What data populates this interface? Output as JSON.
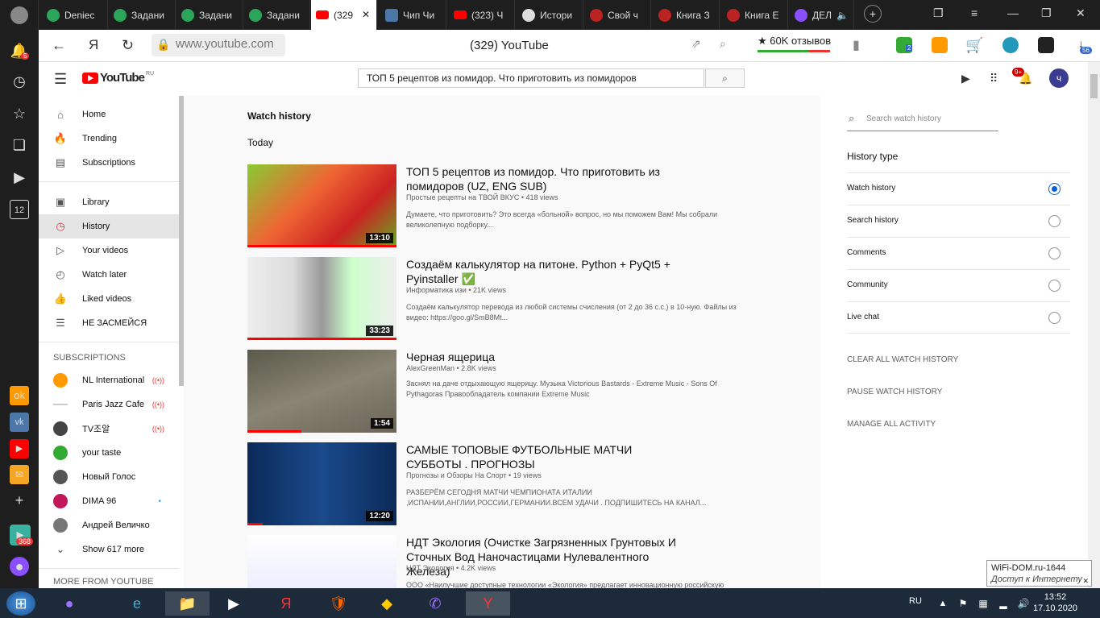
{
  "browser": {
    "tabs": [
      {
        "label": "Deniec",
        "icon": "green-circle-icon",
        "active": false
      },
      {
        "label": "Задани",
        "icon": "green-circle-icon",
        "active": false
      },
      {
        "label": "Задани",
        "icon": "green-circle-icon",
        "active": false
      },
      {
        "label": "Задани",
        "icon": "green-circle-icon",
        "active": false
      },
      {
        "label": "(329",
        "icon": "youtube-icon",
        "active": true
      },
      {
        "label": "Чип Чи",
        "icon": "vk-icon",
        "active": false
      },
      {
        "label": "(323) Ч",
        "icon": "youtube-icon",
        "active": false
      },
      {
        "label": "Истори",
        "icon": "clock-icon",
        "active": false
      },
      {
        "label": "Свой ч",
        "icon": "red-logo-icon",
        "active": false
      },
      {
        "label": "Книга З",
        "icon": "red-logo-icon",
        "active": false
      },
      {
        "label": "Книга Е",
        "icon": "red-logo-icon",
        "active": false
      },
      {
        "label": "ДЕЛ",
        "icon": "purple-icon",
        "active": false
      }
    ],
    "notif_count": "5",
    "left_badge": "12",
    "url": "www.youtube.com",
    "page_title": "(329) YouTube",
    "rating": "★ 60K отзывов",
    "download_count": "56",
    "ext_badge": "2",
    "left_app_badge": "368"
  },
  "yt": {
    "logo": "YouTube",
    "logo_region": "RU",
    "search_value": "ТОП 5 рецептов из помидор. Что приготовить из помидоров",
    "notif_badge": "9+",
    "avatar_letter": "ч"
  },
  "sidebar": {
    "main": [
      "Home",
      "Trending",
      "Subscriptions"
    ],
    "library": [
      "Library",
      "History",
      "Your videos",
      "Watch later",
      "Liked videos",
      "НЕ ЗАСМЕЙСЯ"
    ],
    "subs_header": "SUBSCRIPTIONS",
    "subs": [
      "NL International",
      "Paris Jazz Cafe",
      "TV조알",
      "your taste",
      "Новый Голос",
      "DIMA 96",
      "Андрей Величко"
    ],
    "show_more": "Show 617 more",
    "more_header": "MORE FROM YOUTUBE"
  },
  "main": {
    "title": "Watch history",
    "section": "Today",
    "videos": [
      {
        "title": "ТОП 5 рецептов из помидор. Что приготовить из помидоров (UZ, ENG SUB)",
        "meta": "Простые рецепты на ТВОЙ ВКУС • 418 views",
        "desc": "Думаете, что приготовить? Это всегда «больной» вопрос, но мы поможем Вам! Мы собрали великолепную подборку...",
        "duration": "13:10",
        "progress": 100
      },
      {
        "title": "Создаём калькулятор на питоне. Python + PyQt5 + Pyinstaller ✅",
        "meta": "Информатика изи • 21K views",
        "desc": "Создаём калькулятор перевода из любой системы счисления (от 2 до 36 с.с.) в 10-ную. Файлы из видео: https://goo.gl/SmB8Mt...",
        "duration": "33:23",
        "progress": 100
      },
      {
        "title": "Черная ящерица",
        "meta": "AlexGreenMan • 2.8K views",
        "desc": "Заснял на даче отдыхающую ящерицу. Музыка Victorious Bastards - Extreme Music - Sons Of Pythagoras Правообладатель компании Extreme Music",
        "duration": "1:54",
        "progress": 36
      },
      {
        "title": "САМЫЕ ТОПОВЫЕ ФУТБОЛЬНЫЕ МАТЧИ СУББОТЫ . ПРОГНОЗЫ",
        "meta": "Прогнозы и Обзоры На Спорт • 19 views",
        "desc": "РАЗБЕРЁМ СЕГОДНЯ МАТЧИ ЧЕМПИОНАТА ИТАЛИИ ,ИСПАНИИ,АНГЛИИ,РОССИИ,ГЕРМАНИИ.ВСЕМ УДАЧИ . ПОДПИШИТЕСЬ НА КАНАЛ...",
        "duration": "12:20",
        "progress": 10
      },
      {
        "title": "НДТ Экология (Очистке Загрязненных Грунтовых И Сточных Вод Наночастицами Нулевалентного Железа)",
        "meta": "НДТ Экология • 4.2K views",
        "desc": "ООО «Наилучшие доступные технологии «Экология» предлагает инновационную российскую",
        "duration": "",
        "progress": 0
      }
    ]
  },
  "right": {
    "search_placeholder": "Search watch history",
    "history_type": "History type",
    "options": [
      "Watch history",
      "Search history",
      "Comments",
      "Community",
      "Live chat"
    ],
    "actions": [
      "CLEAR ALL WATCH HISTORY",
      "PAUSE WATCH HISTORY",
      "MANAGE ALL ACTIVITY"
    ]
  },
  "tooltip": {
    "line1": "WiFi-DOM.ru-1644",
    "line2": "Доступ к Интернету"
  },
  "taskbar": {
    "lang": "RU",
    "time": "13:52",
    "date": "17.10.2020"
  },
  "colors": {
    "yt_red": "#ff0000",
    "accent_blue": "#065fd4",
    "selected_bg": "#e5e5e5"
  }
}
